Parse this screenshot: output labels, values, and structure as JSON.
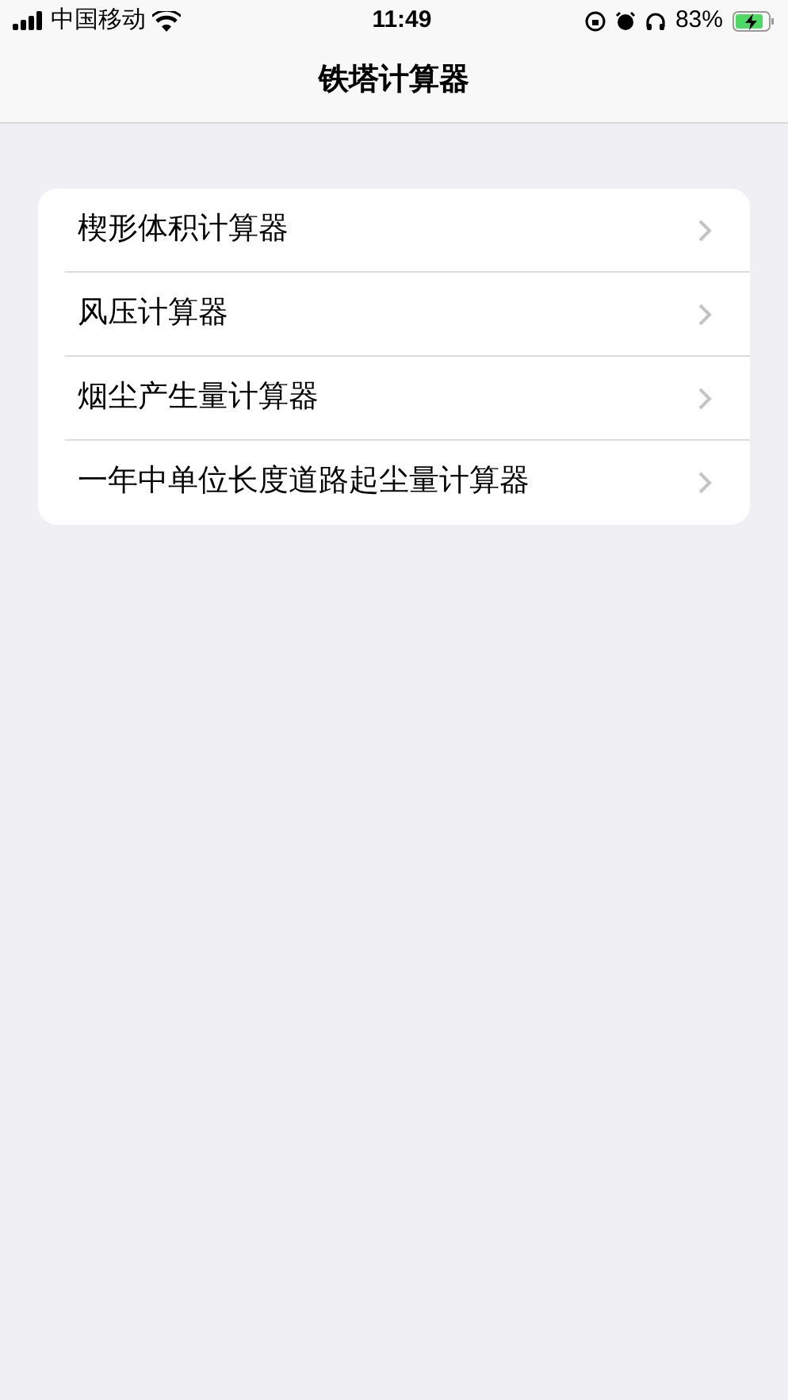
{
  "status_bar": {
    "carrier": "中国移动",
    "time": "11:49",
    "battery": "83%"
  },
  "nav": {
    "title": "铁塔计算器"
  },
  "items": [
    {
      "label": "楔形体积计算器"
    },
    {
      "label": "风压计算器"
    },
    {
      "label": "烟尘产生量计算器"
    },
    {
      "label": "一年中单位长度道路起尘量计算器"
    }
  ]
}
